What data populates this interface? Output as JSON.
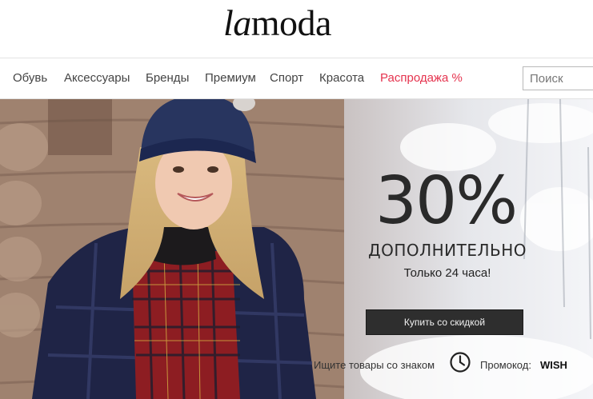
{
  "header": {
    "logo_part1": "la",
    "logo_part2": "moda"
  },
  "nav": {
    "items": [
      "Обувь",
      "Аксессуары",
      "Бренды",
      "Премиум",
      "Спорт",
      "Красота",
      "Распродажа %"
    ],
    "search_placeholder": "Поиск"
  },
  "hero": {
    "headline": "30%",
    "subheadline": "ДОПОЛНИТЕЛЬНО",
    "note": "Только 24 часа!",
    "cta_label": "Купить со скидкой",
    "hint_text": "Ищите товары со знаком",
    "hint_icon": "clock-icon",
    "promo_label": "Промокод:",
    "promo_code": "WISH"
  },
  "colors": {
    "sale": "#e5334e",
    "cta_bg": "#2e2e2e",
    "text_dark": "#2a2a2a"
  }
}
